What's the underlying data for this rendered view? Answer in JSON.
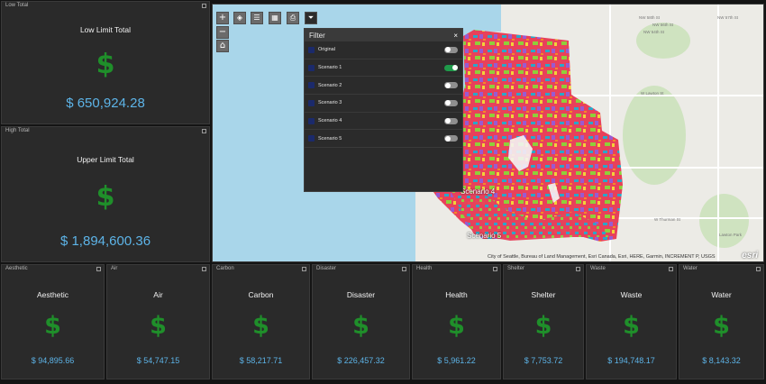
{
  "low_total": {
    "tag": "Low Total",
    "title": "Low Limit Total",
    "value": "$ 650,924.28"
  },
  "high_total": {
    "tag": "High Total",
    "title": "Upper Limit Total",
    "value": "$ 1,894,600.36"
  },
  "currency_symbol": "$",
  "categories": [
    {
      "tag": "Aesthetic",
      "title": "Aesthetic",
      "value": "$ 94,895.66"
    },
    {
      "tag": "Air",
      "title": "Air",
      "value": "$ 54,747.15"
    },
    {
      "tag": "Carbon",
      "title": "Carbon",
      "value": "$ 58,217.71"
    },
    {
      "tag": "Disaster",
      "title": "Disaster",
      "value": "$ 226,457.32"
    },
    {
      "tag": "Health",
      "title": "Health",
      "value": "$ 5,961.22"
    },
    {
      "tag": "Shelter",
      "title": "Shelter",
      "value": "$ 7,753.72"
    },
    {
      "tag": "Waste",
      "title": "Waste",
      "value": "$ 194,748.17"
    },
    {
      "tag": "Water",
      "title": "Water",
      "value": "$ 8,143.32"
    }
  ],
  "map": {
    "tools": {
      "zoom_in": "+",
      "zoom_out": "−",
      "home": "⌂",
      "layers": "◈",
      "legend": "☰",
      "basemap": "▦",
      "print": "⎙",
      "filter": "⏷"
    },
    "scenario_labels": [
      "Scenario 4",
      "Scenario 5"
    ],
    "street_labels": [
      "NW 58th St",
      "NW 57th St",
      "NW 56th St",
      "NW 54th St",
      "W Lawton St",
      "W Thurman St",
      "Lawton Park"
    ],
    "attribution": "City of Seattle, Bureau of Land Management, Esri Canada, Esri, HERE, Garmin, INCREMENT P, USGS",
    "logo": "esri"
  },
  "filter": {
    "title": "Filter",
    "close": "×",
    "items": [
      {
        "label": "Original",
        "on": false
      },
      {
        "label": "Scenario 1",
        "on": true
      },
      {
        "label": "Scenario 2",
        "on": false
      },
      {
        "label": "Scenario 3",
        "on": false
      },
      {
        "label": "Scenario 4",
        "on": false
      },
      {
        "label": "Scenario 5",
        "on": false
      }
    ]
  }
}
